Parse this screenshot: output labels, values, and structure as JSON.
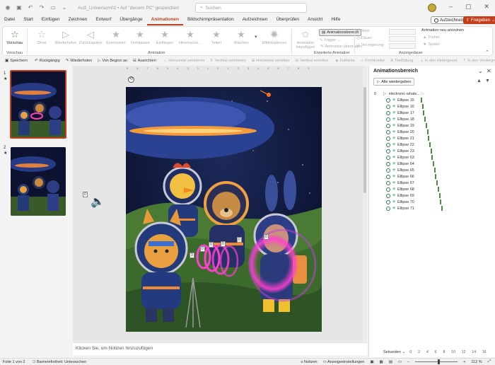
{
  "titlebar": {
    "doc_title": "AuS_Universum02 • Auf \"diesem PC\" gespeichert",
    "search_placeholder": "Suchen",
    "icons": [
      "autosave-toggle-icon",
      "save-icon",
      "undo-icon",
      "redo-icon",
      "slideshow-start-icon",
      "customize-qat-icon"
    ]
  },
  "menu": {
    "items": [
      "Datei",
      "Start",
      "Einfügen",
      "Zeichnen",
      "Entwurf",
      "Übergänge",
      "Animationen",
      "Bildschirmpräsentation",
      "Aufzeichnen",
      "Überprüfen",
      "Ansicht",
      "Hilfe"
    ],
    "active_index": 6,
    "record_label": "Aufzeichnen",
    "share_label": "Freigeben"
  },
  "ribbon": {
    "preview_label": "Vorschau",
    "preview_group": "Vorschau",
    "effects": [
      "Ohne",
      "Wiederholen",
      "Zurückspulen",
      "Erscheinen",
      "Verblassen",
      "Einfliegen",
      "Hineinsche...",
      "Teilen",
      "Wischen"
    ],
    "effect_options_label": "Effektoptionen",
    "animation_group": "Animation",
    "add_animation_label": "Animation hinzufügen",
    "animation_pane_label": "Animationsbereich",
    "trigger_label": "Trigger",
    "animation_painter_label": "Animation übertragen",
    "advanced_group": "Erweiterte Animation",
    "start_label": "Start:",
    "duration_label": "Dauer:",
    "delay_label": "Verzögerung:",
    "timing_group": "Anzeigedauer",
    "reorder_label": "Animation neu anordnen",
    "earlier_label": "Früher",
    "later_label": "Später"
  },
  "qat": {
    "items": [
      {
        "label": "Speichern",
        "enabled": true
      },
      {
        "label": "Rückgängig",
        "enabled": true
      },
      {
        "label": "Wiederholen",
        "enabled": true
      },
      {
        "label": "Von Beginn an",
        "enabled": true
      },
      {
        "label": "Ausrichten",
        "enabled": true
      },
      {
        "label": "Horizontal zentrieren",
        "enabled": false
      },
      {
        "label": "Vertikal zentrieren",
        "enabled": false
      },
      {
        "label": "Horizontal verteilen",
        "enabled": false
      },
      {
        "label": "Vertikal verteilen",
        "enabled": false
      },
      {
        "label": "Füllfarbe",
        "enabled": false
      },
      {
        "label": "Formkontur",
        "enabled": false
      },
      {
        "label": "Textfüllung",
        "enabled": false
      },
      {
        "label": "In den Hintergrund",
        "enabled": false
      },
      {
        "label": "In den Vordergrund",
        "enabled": false
      }
    ]
  },
  "thumbnails": [
    {
      "number": "1",
      "star": "★",
      "selected": true
    },
    {
      "number": "2",
      "star": "★",
      "selected": false
    }
  ],
  "editor": {
    "ruler_h": [
      "9",
      "8",
      "7",
      "6",
      "5",
      "4",
      "3",
      "2",
      "1",
      "0",
      "1",
      "2",
      "3",
      "4",
      "5",
      "6",
      "7",
      "8",
      "9"
    ],
    "speaker_tag": "0",
    "tags": [
      "0",
      "0",
      "0",
      "0",
      "0",
      "0"
    ],
    "notes_placeholder": "Klicken Sie, um Notizen hinzuzufügen"
  },
  "animation_pane": {
    "title": "Animationsbereich",
    "play_all_label": "Alle wiedergeben",
    "items": [
      {
        "num": "0",
        "label": "electronic-whale...",
        "type": "trigger"
      },
      {
        "num": "",
        "label": "Ellipse 15",
        "type": "effect",
        "offset": 0
      },
      {
        "num": "",
        "label": "Ellipse 16",
        "type": "effect",
        "offset": 1
      },
      {
        "num": "",
        "label": "Ellipse 17",
        "type": "effect",
        "offset": 2
      },
      {
        "num": "",
        "label": "Ellipse 18",
        "type": "effect",
        "offset": 3
      },
      {
        "num": "",
        "label": "Ellipse 19",
        "type": "effect",
        "offset": 4
      },
      {
        "num": "",
        "label": "Ellipse 20",
        "type": "effect",
        "offset": 5
      },
      {
        "num": "",
        "label": "Ellipse 21",
        "type": "effect",
        "offset": 6
      },
      {
        "num": "",
        "label": "Ellipse 22",
        "type": "effect",
        "offset": 7
      },
      {
        "num": "",
        "label": "Ellipse 23",
        "type": "effect",
        "offset": 8
      },
      {
        "num": "",
        "label": "Ellipse 63",
        "type": "effect",
        "offset": 9
      },
      {
        "num": "",
        "label": "Ellipse 64",
        "type": "effect",
        "offset": 10
      },
      {
        "num": "",
        "label": "Ellipse 65",
        "type": "effect",
        "offset": 11
      },
      {
        "num": "",
        "label": "Ellipse 66",
        "type": "effect",
        "offset": 12
      },
      {
        "num": "",
        "label": "Ellipse 67",
        "type": "effect",
        "offset": 13
      },
      {
        "num": "",
        "label": "Ellipse 68",
        "type": "effect",
        "offset": 14
      },
      {
        "num": "",
        "label": "Ellipse 69",
        "type": "effect",
        "offset": 15
      },
      {
        "num": "",
        "label": "Ellipse 70",
        "type": "effect",
        "offset": 16
      },
      {
        "num": "",
        "label": "Ellipse 71",
        "type": "effect",
        "offset": 17
      }
    ],
    "seconds_label": "Sekunden",
    "timeline": [
      "0",
      "2",
      "4",
      "6",
      "8",
      "10",
      "12",
      "14",
      "16"
    ]
  },
  "statusbar": {
    "slide_info": "Folie 1 von 2",
    "accessibility": "Barrierefreiheit: Untersuchen",
    "notes_label": "Notizen",
    "display_settings": "Anzeigeeinstellungen",
    "zoom": "112 %"
  },
  "colors": {
    "accent": "#c43e1c",
    "effect_green": "#2e9b4f"
  }
}
